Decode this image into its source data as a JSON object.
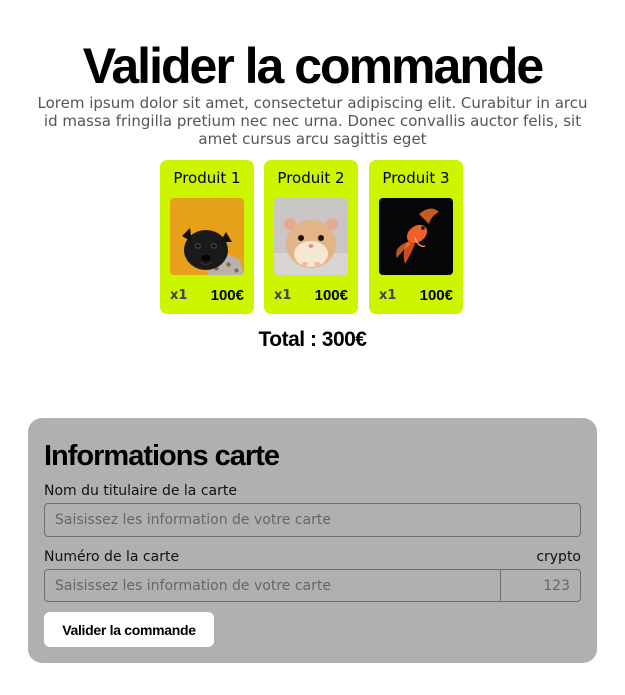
{
  "header": {
    "title": "Valider la commande",
    "description": "Lorem ipsum dolor sit amet, consectetur adipiscing elit. Curabitur in arcu id massa fringilla pretium nec nec urna. Donec convallis auctor felis, sit amet cursus arcu sagittis eget"
  },
  "products": [
    {
      "name": "Produit 1",
      "image": "pug-photo",
      "quantity": "x1",
      "price": "100€"
    },
    {
      "name": "Produit 2",
      "image": "hamster-photo",
      "quantity": "x1",
      "price": "100€"
    },
    {
      "name": "Produit 3",
      "image": "goldfish-photo",
      "quantity": "x1",
      "price": "100€"
    }
  ],
  "total": "Total : 300€",
  "card_form": {
    "title": "Informations carte",
    "holder_label": "Nom du titulaire de la carte",
    "holder_placeholder": "Saisissez les information de votre carte",
    "number_label": "Numéro de la carte",
    "number_placeholder": "Saisissez les information de votre carte",
    "crypto_label": "crypto",
    "crypto_placeholder": "123",
    "submit_label": "Valider la commande"
  },
  "colors": {
    "accent": "#ccf500",
    "panel": "#b0b0b0"
  }
}
